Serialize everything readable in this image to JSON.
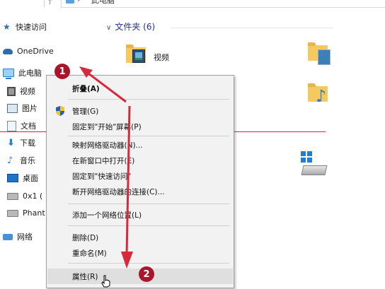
{
  "address_bar": {
    "separator": "›",
    "crumb": "›",
    "crumb_tail": "此电脑"
  },
  "nav": {
    "items": [
      {
        "label": "快速访问",
        "icon": "star-icon"
      },
      {
        "label": "OneDrive",
        "icon": "cloud-icon"
      },
      {
        "label": "此电脑",
        "icon": "computer-icon"
      },
      {
        "label": "视频",
        "icon": "video-icon"
      },
      {
        "label": "图片",
        "icon": "pictures-icon"
      },
      {
        "label": "文档",
        "icon": "documents-icon"
      },
      {
        "label": "下载",
        "icon": "download-icon"
      },
      {
        "label": "音乐",
        "icon": "music-icon"
      },
      {
        "label": "桌面",
        "icon": "desktop-icon"
      },
      {
        "label": "0x1 (",
        "icon": "drive-icon"
      },
      {
        "label": "Phant",
        "icon": "drive-icon"
      },
      {
        "label": "网络",
        "icon": "network-icon"
      }
    ]
  },
  "content": {
    "group_header": "文件夹 (6)",
    "folders": [
      {
        "label": "视频"
      }
    ]
  },
  "context_menu": {
    "items": [
      {
        "label": "折叠(A)",
        "bold": true
      },
      {
        "label": "管理(G)",
        "icon": "shield-icon"
      },
      {
        "label": "固定到\"开始\"屏幕(P)"
      },
      {
        "label": "映射网络驱动器(N)..."
      },
      {
        "label": "在新窗口中打开(E)"
      },
      {
        "label": "固定到\"快速访问\""
      },
      {
        "label": "断开网络驱动器的连接(C)..."
      },
      {
        "label": "添加一个网络位置(L)"
      },
      {
        "label": "删除(D)"
      },
      {
        "label": "重命名(M)"
      },
      {
        "label": "属性(R)",
        "highlighted": true
      }
    ]
  },
  "annotations": {
    "step1": "1",
    "step2": "2",
    "color": "#a8162a",
    "line_color": "#d8283b"
  }
}
